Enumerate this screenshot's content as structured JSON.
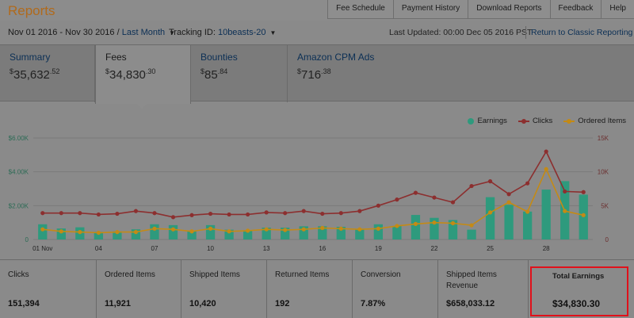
{
  "app": {
    "title": "Reports"
  },
  "top_nav": [
    "Fee Schedule",
    "Payment History",
    "Download Reports",
    "Feedback",
    "Help"
  ],
  "filters": {
    "date_range": "Nov 01 2016 - Nov 30 2016 /",
    "date_preset": "Last Month",
    "tracking_label": "Tracking ID:",
    "tracking_id": "10beasts-20",
    "last_updated": "Last Updated: 00:00 Dec 05 2016 PST",
    "classic_link": "Return to Classic Reporting"
  },
  "tabs": [
    {
      "label": "Summary",
      "value_main": "35,632",
      "value_cents": "52"
    },
    {
      "label": "Fees",
      "value_main": "34,830",
      "value_cents": "30"
    },
    {
      "label": "Bounties",
      "value_main": "85",
      "value_cents": "84"
    },
    {
      "label": "Amazon CPM Ads",
      "value_main": "716",
      "value_cents": "38"
    }
  ],
  "currency_symbol": "$",
  "colors": {
    "earnings": "#2e9a7d",
    "clicks": "#8c2f2f",
    "ordered": "#c48a15",
    "accent": "#b06a1c",
    "highlight_border": "#e0111b"
  },
  "chart_data": {
    "type": "bar+line",
    "legend_position": "top-right",
    "categories": [
      "01 Nov",
      "02",
      "03",
      "04",
      "05",
      "06",
      "07",
      "08",
      "09",
      "10",
      "11",
      "12",
      "13",
      "14",
      "15",
      "16",
      "17",
      "18",
      "19",
      "20",
      "21",
      "22",
      "23",
      "24",
      "25",
      "26",
      "27",
      "28",
      "29",
      "30"
    ],
    "x_tick_labels": [
      "01 Nov",
      "",
      "",
      "04",
      "",
      "",
      "07",
      "",
      "",
      "10",
      "",
      "",
      "13",
      "",
      "",
      "16",
      "",
      "",
      "19",
      "",
      "",
      "22",
      "",
      "",
      "25",
      "",
      "",
      "28",
      "",
      ""
    ],
    "y_left": {
      "ticks": [
        "0",
        "$2.00K",
        "$4.00K",
        "$6.00K"
      ],
      "range": [
        0,
        6000
      ]
    },
    "y_right": {
      "ticks": [
        "0",
        "5K",
        "10K",
        "15K"
      ],
      "range": [
        0,
        15000
      ]
    },
    "series": [
      {
        "name": "Earnings",
        "type": "bar",
        "axis": "left",
        "values": [
          900,
          650,
          720,
          450,
          480,
          600,
          900,
          850,
          520,
          850,
          580,
          550,
          700,
          700,
          780,
          780,
          750,
          620,
          900,
          800,
          1450,
          1280,
          1150,
          580,
          2500,
          2050,
          1650,
          2950,
          3450,
          2650
        ]
      },
      {
        "name": "Clicks",
        "type": "line",
        "axis": "right",
        "values": [
          3900,
          3900,
          3900,
          3700,
          3800,
          4200,
          3900,
          3300,
          3600,
          3800,
          3700,
          3700,
          4000,
          3900,
          4200,
          3800,
          3900,
          4200,
          5000,
          5900,
          6900,
          6200,
          5500,
          7900,
          8600,
          6700,
          8300,
          13000,
          7100,
          7000
        ]
      },
      {
        "name": "Ordered Items",
        "type": "line",
        "axis": "right",
        "values": [
          1500,
          1200,
          1100,
          1000,
          1100,
          1100,
          1600,
          1500,
          1200,
          1600,
          1200,
          1300,
          1500,
          1400,
          1500,
          1700,
          1600,
          1500,
          1600,
          2000,
          2300,
          2500,
          2400,
          2100,
          4000,
          5500,
          4100,
          10400,
          4200,
          3600
        ]
      }
    ]
  },
  "metrics": [
    {
      "label": "Clicks",
      "value": "151,394"
    },
    {
      "label": "Ordered Items",
      "value": "11,921"
    },
    {
      "label": "Shipped Items",
      "value": "10,420"
    },
    {
      "label": "Returned Items",
      "value": "192"
    },
    {
      "label": "Conversion",
      "value": "7.87%"
    },
    {
      "label": "Shipped Items Revenue",
      "value": "$658,033.12"
    },
    {
      "label": "Total Earnings",
      "value": "$34,830.30"
    }
  ]
}
